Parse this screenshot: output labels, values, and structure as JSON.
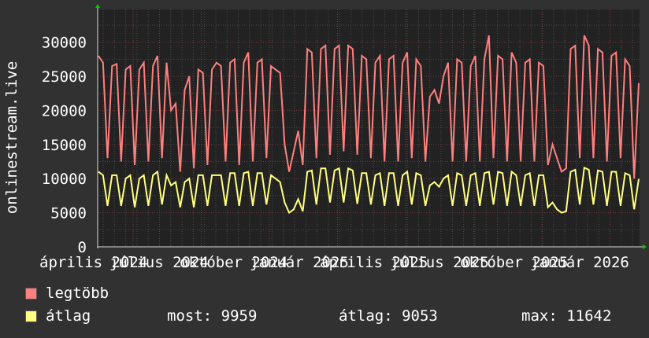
{
  "chart_data": {
    "type": "line",
    "ylabel": "onlinestream.live",
    "ylim": [
      0,
      34800
    ],
    "yticks": [
      "0",
      "5000",
      "10000",
      "15000",
      "20000",
      "25000",
      "30000"
    ],
    "xtick_labels": [
      "április 2024",
      "július 2024",
      "október 2024",
      "január 2025",
      "április 2025",
      "július 2025",
      "október 2025",
      "január 2026"
    ],
    "grid": true,
    "series": [
      {
        "name": "legtöbb",
        "color": "#ff7f7f",
        "values": [
          28000,
          27000,
          13000,
          26500,
          26800,
          12500,
          26000,
          26500,
          12000,
          26000,
          27000,
          12500,
          26500,
          28000,
          13000,
          27000,
          20000,
          21000,
          11000,
          23000,
          25000,
          11500,
          26000,
          25500,
          12000,
          26000,
          27000,
          26500,
          12500,
          27000,
          27500,
          12000,
          27000,
          28500,
          12500,
          27000,
          27500,
          13000,
          26500,
          26000,
          25500,
          15000,
          11000,
          14000,
          17000,
          12000,
          29000,
          28500,
          13000,
          29000,
          29500,
          13500,
          29000,
          29500,
          14000,
          29500,
          29000,
          13500,
          28000,
          27500,
          13000,
          27000,
          28000,
          12500,
          27500,
          28000,
          12500,
          27000,
          28500,
          13000,
          27500,
          26500,
          12500,
          22000,
          23000,
          21000,
          25000,
          27000,
          12500,
          27500,
          27000,
          12500,
          26500,
          28000,
          12500,
          27500,
          31000,
          13000,
          28000,
          27500,
          12500,
          28500,
          27000,
          12500,
          27000,
          27500,
          12500,
          27000,
          26500,
          12000,
          15000,
          13000,
          11000,
          11500,
          29000,
          29500,
          13000,
          31000,
          29500,
          13000,
          29000,
          28500,
          12500,
          28000,
          28500,
          13000,
          27500,
          26500,
          10000,
          24000
        ]
      },
      {
        "name": "átlag",
        "color": "#ffff80",
        "values": [
          11000,
          10500,
          6000,
          10500,
          10500,
          6000,
          10000,
          10500,
          5800,
          10000,
          10500,
          6000,
          10500,
          11000,
          6200,
          10500,
          9000,
          9500,
          5800,
          9500,
          10000,
          5800,
          10500,
          10500,
          6000,
          10500,
          10500,
          10500,
          6000,
          10800,
          10800,
          6000,
          10800,
          11000,
          6000,
          10800,
          10800,
          6200,
          10500,
          10000,
          9500,
          6500,
          5000,
          5500,
          7000,
          5200,
          11000,
          11200,
          6200,
          11500,
          11500,
          6500,
          11200,
          11500,
          6500,
          11500,
          11200,
          6300,
          10800,
          10800,
          6200,
          10500,
          10800,
          6000,
          10800,
          10800,
          6000,
          10500,
          11000,
          6200,
          10800,
          10500,
          6000,
          9000,
          9500,
          8800,
          10000,
          10500,
          6000,
          10800,
          10500,
          6000,
          10500,
          10800,
          6000,
          10800,
          11000,
          6200,
          11000,
          10800,
          6000,
          11000,
          10500,
          6000,
          10500,
          10800,
          6000,
          10500,
          10500,
          5800,
          6500,
          5500,
          5000,
          5200,
          11000,
          11300,
          6200,
          11600,
          11300,
          6200,
          11200,
          11000,
          6000,
          11000,
          11000,
          6000,
          10800,
          10500,
          5500,
          9959
        ]
      }
    ]
  },
  "legend": {
    "max_label": "legtöbb",
    "avg_label": "átlag",
    "now_text": "most: 9959",
    "avg_text": "átlag: 9053",
    "max_text": "max: 11642"
  }
}
